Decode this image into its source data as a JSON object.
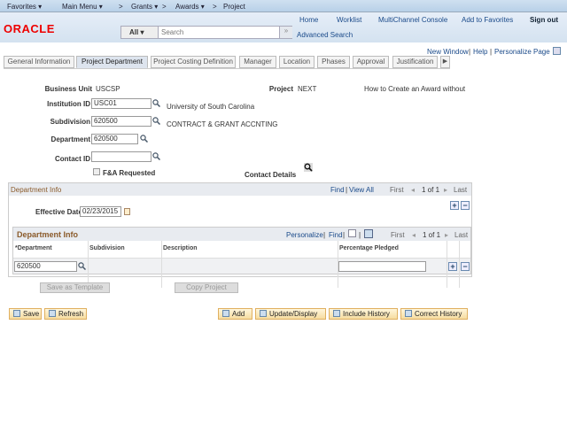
{
  "topbar": {
    "favorites": "Favorites ▾",
    "main_menu": "Main Menu ▾",
    "crumbs": [
      "Grants ▾",
      "Awards ▾",
      "Project"
    ],
    "sep": ">"
  },
  "header": {
    "logo": "ORACLE",
    "links": [
      "Home",
      "Worklist",
      "MultiChannel Console",
      "Add to Favorites",
      "Sign out"
    ],
    "search_scope": "All",
    "search_placeholder": "Search",
    "advanced_search": "Advanced Search"
  },
  "pagebar": {
    "new_window": "New Window",
    "help": "Help",
    "personalize": "Personalize Page"
  },
  "tabs": [
    "General Information",
    "Project Department",
    "Project Costing Definition",
    "Manager",
    "Location",
    "Phases",
    "Approval",
    "Justification"
  ],
  "form": {
    "business_unit_label": "Business Unit",
    "business_unit": "USCSP",
    "project_label": "Project",
    "project": "NEXT",
    "project_desc": "How to Create an Award without",
    "institution_label": "Institution ID",
    "institution": "USC01",
    "institution_desc": "University of South Carolina",
    "subdivision_label": "Subdivision",
    "subdivision": "620500",
    "subdivision_desc": "CONTRACT & GRANT ACCNTING",
    "department_label": "Department",
    "department": "620500",
    "contact_label": "Contact ID",
    "contact": "",
    "fa_label": "F&A Requested",
    "fa_checked": false,
    "contact_details": "Contact Details"
  },
  "dept_info": {
    "title": "Department Info",
    "find": "Find",
    "view_all": "View All",
    "first": "First",
    "count": "1 of 1",
    "last": "Last",
    "eff_label": "Effective Date",
    "eff_date": "02/23/2015"
  },
  "grid": {
    "title": "Department Info",
    "personalize": "Personalize",
    "find": "Find",
    "first": "First",
    "count": "1 of 1",
    "last": "Last",
    "columns": [
      "*Department",
      "Subdivision",
      "Description",
      "Percentage Pledged"
    ],
    "rows": [
      {
        "department": "620500",
        "subdivision": "",
        "description": "",
        "percentage": ""
      }
    ]
  },
  "actions": {
    "save_template": "Save as Template",
    "copy_project": "Copy Project"
  },
  "buttons": {
    "save": "Save",
    "refresh": "Refresh",
    "add": "Add",
    "update": "Update/Display",
    "include_history": "Include History",
    "correct_history": "Correct History"
  }
}
